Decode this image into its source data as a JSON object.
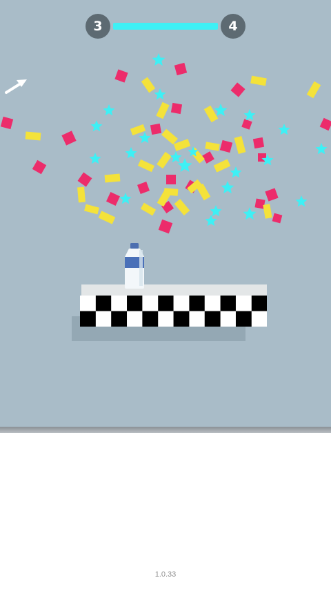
{
  "level": {
    "current": "3",
    "next": "4",
    "progress_fraction": 1.0
  },
  "hint": {
    "icon": "arrow-up-right-icon"
  },
  "confetti_colors": {
    "pink": "#ec2c6b",
    "yellow": "#f4e23a",
    "cyan": "#3ef0f5"
  },
  "colors": {
    "sky": "#a9bcc8",
    "badge": "#5d6a72",
    "progress": "#3ef0f5"
  },
  "object": {
    "name": "water-bottle"
  },
  "footer": {
    "version": "1.0.33"
  }
}
